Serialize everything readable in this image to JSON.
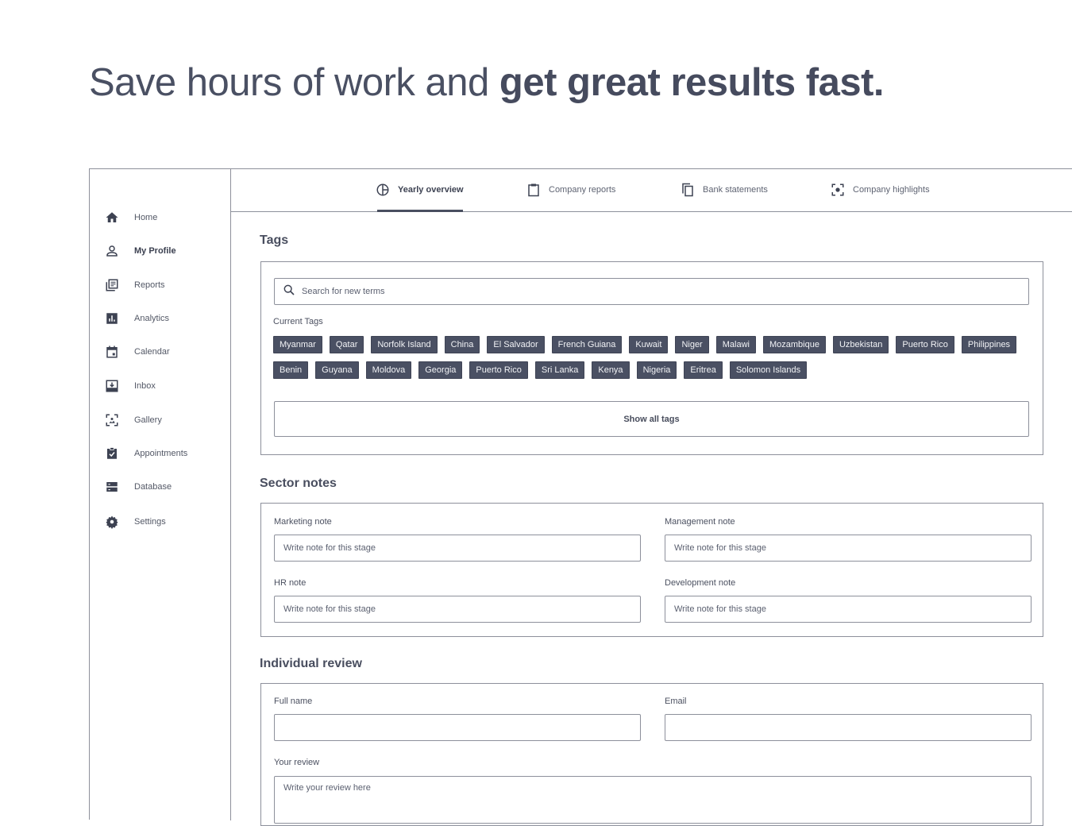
{
  "headline": {
    "normal": "Save hours of work and ",
    "bold": "get great results fast."
  },
  "sidebar": {
    "items": [
      {
        "label": "Home",
        "icon": "home-icon"
      },
      {
        "label": "My Profile",
        "icon": "person-icon"
      },
      {
        "label": "Reports",
        "icon": "reports-icon"
      },
      {
        "label": "Analytics",
        "icon": "analytics-icon"
      },
      {
        "label": "Calendar",
        "icon": "calendar-icon"
      },
      {
        "label": "Inbox",
        "icon": "inbox-icon"
      },
      {
        "label": "Gallery",
        "icon": "gallery-icon"
      },
      {
        "label": "Appointments",
        "icon": "appointments-icon"
      },
      {
        "label": "Database",
        "icon": "database-icon"
      },
      {
        "label": "Settings",
        "icon": "gear-icon"
      }
    ],
    "active": "My Profile"
  },
  "tabs": [
    {
      "label": "Yearly overview",
      "icon": "pie-chart-icon"
    },
    {
      "label": "Company reports",
      "icon": "clipboard-icon"
    },
    {
      "label": "Bank statements",
      "icon": "copy-icon"
    },
    {
      "label": "Company highlights",
      "icon": "focus-icon"
    }
  ],
  "tags": {
    "title": "Tags",
    "search_placeholder": "Search for new terms",
    "current_label": "Current Tags",
    "row1": [
      "Myanmar",
      "Qatar",
      "Norfolk Island",
      "China",
      "El Salvador",
      "French Guiana",
      "Kuwait",
      "Niger",
      "Malawi",
      "Mozambique",
      "Uzbekistan",
      "Puerto Rico",
      "Philippines"
    ],
    "row2": [
      "Benin",
      "Guyana",
      "Moldova",
      "Georgia",
      "Puerto Rico",
      "Sri Lanka",
      "Kenya",
      "Nigeria",
      "Eritrea",
      "Solomon Islands"
    ],
    "show_all": "Show all tags"
  },
  "sector": {
    "title": "Sector notes",
    "marketing_label": "Marketing note",
    "management_label": "Management note",
    "hr_label": "HR note",
    "development_label": "Development note",
    "note_placeholder": "Write note for this stage"
  },
  "review": {
    "title": "Individual review",
    "fullname_label": "Full name",
    "email_label": "Email",
    "review_label": "Your review",
    "review_placeholder": "Write your review here"
  },
  "colors": {
    "tag_bg": "#4a5063",
    "text": "#454a5c",
    "border": "#8d909b"
  }
}
